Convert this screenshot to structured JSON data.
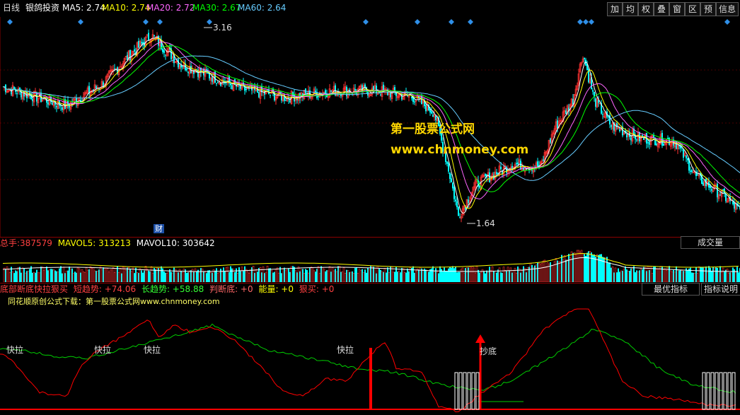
{
  "header": {
    "period": "日线",
    "stock_name": "银鸽投资",
    "ma": [
      {
        "label": "MA5: 2.74",
        "color": "#ffffff"
      },
      {
        "label": "MA10: 2.74",
        "color": "#ffff00"
      },
      {
        "label": "MA20: 2.72",
        "color": "#ff66ff"
      },
      {
        "label": "MA30: 2.67",
        "color": "#00ff00"
      },
      {
        "label": "MA60: 2.64",
        "color": "#66ccff"
      }
    ]
  },
  "toolbar": {
    "buttons": [
      "加",
      "均",
      "权",
      "叠",
      "窗",
      "区",
      "预",
      "信息"
    ]
  },
  "main_chart": {
    "high_label": "3.16",
    "low_label": "1.64",
    "finance_marker": "财",
    "watermark_line1": "第一股票公式网",
    "watermark_line2": "www.chnmoney.com"
  },
  "volume_panel": {
    "title": "总手:",
    "total": "387579",
    "mavol5": "MAVOL5: 313213",
    "mavol10": "MAVOL10: 303642",
    "button": "成交量"
  },
  "indicator_panel": {
    "name": "底部断底快拉狠买",
    "short": "短趋势: +74.06",
    "long": "长趋势: +58.88",
    "judge": "判断底: +0",
    "energy": "能量: +0",
    "buy": "狠买: +0",
    "btn_best": "最优指标",
    "btn_explain": "指标说明",
    "promo": "同花顺原创公式下载：第一股票公式网www.chnmoney.com",
    "signals": [
      "快拉",
      "快拉",
      "快拉",
      "快拉",
      "抄底"
    ]
  },
  "colors": {
    "up": "#ff3232",
    "down": "#00ffff",
    "short_trend": "#ff0000",
    "long_trend": "#00cc00"
  },
  "chart_data": {
    "type": "candlestick",
    "price_extremes": {
      "high": 3.16,
      "low": 1.64
    },
    "moving_averages": {
      "MA5": 2.74,
      "MA10": 2.74,
      "MA20": 2.72,
      "MA30": 2.67,
      "MA60": 2.64
    },
    "volume": {
      "total": 387579,
      "MAVOL5": 313213,
      "MAVOL10": 303642
    },
    "indicator": {
      "short_trend": 74.06,
      "long_trend": 58.88,
      "judge_bottom": 0,
      "energy": 0,
      "heavy_buy": 0
    }
  }
}
